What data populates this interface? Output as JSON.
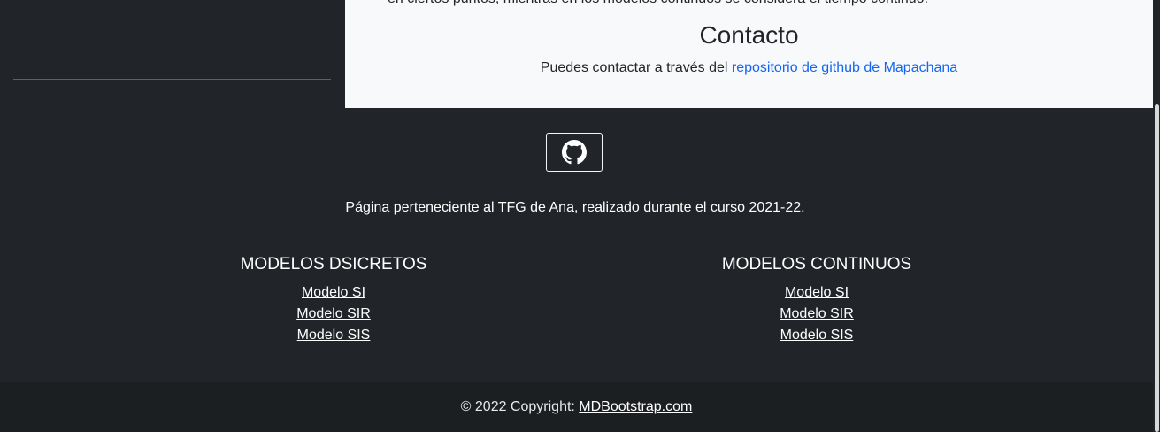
{
  "main": {
    "truncated_text": "en ciertos puntos, mientras en los modelos continuos se considera el tiempo continuo.",
    "contact_title": "Contacto",
    "contact_prefix": "Puedes contactar a través del ",
    "contact_link": "repositorio de github de Mapachana"
  },
  "footer": {
    "github_icon": "github-icon",
    "tfg_text": "Página perteneciente al TFG de Ana, realizado durante el curso 2021-22.",
    "columns": [
      {
        "title": "MODELOS DSICRETOS",
        "links": [
          "Modelo SI",
          "Modelo SIR",
          "Modelo SIS"
        ]
      },
      {
        "title": "MODELOS CONTINUOS",
        "links": [
          "Modelo SI",
          "Modelo SIR",
          "Modelo SIS"
        ]
      }
    ],
    "copyright_prefix": "© 2022 Copyright: ",
    "copyright_link": "MDBootstrap.com"
  },
  "colors": {
    "footer_bg": "#212529",
    "content_bg": "#f8f9fa",
    "link": "#1266f1"
  }
}
